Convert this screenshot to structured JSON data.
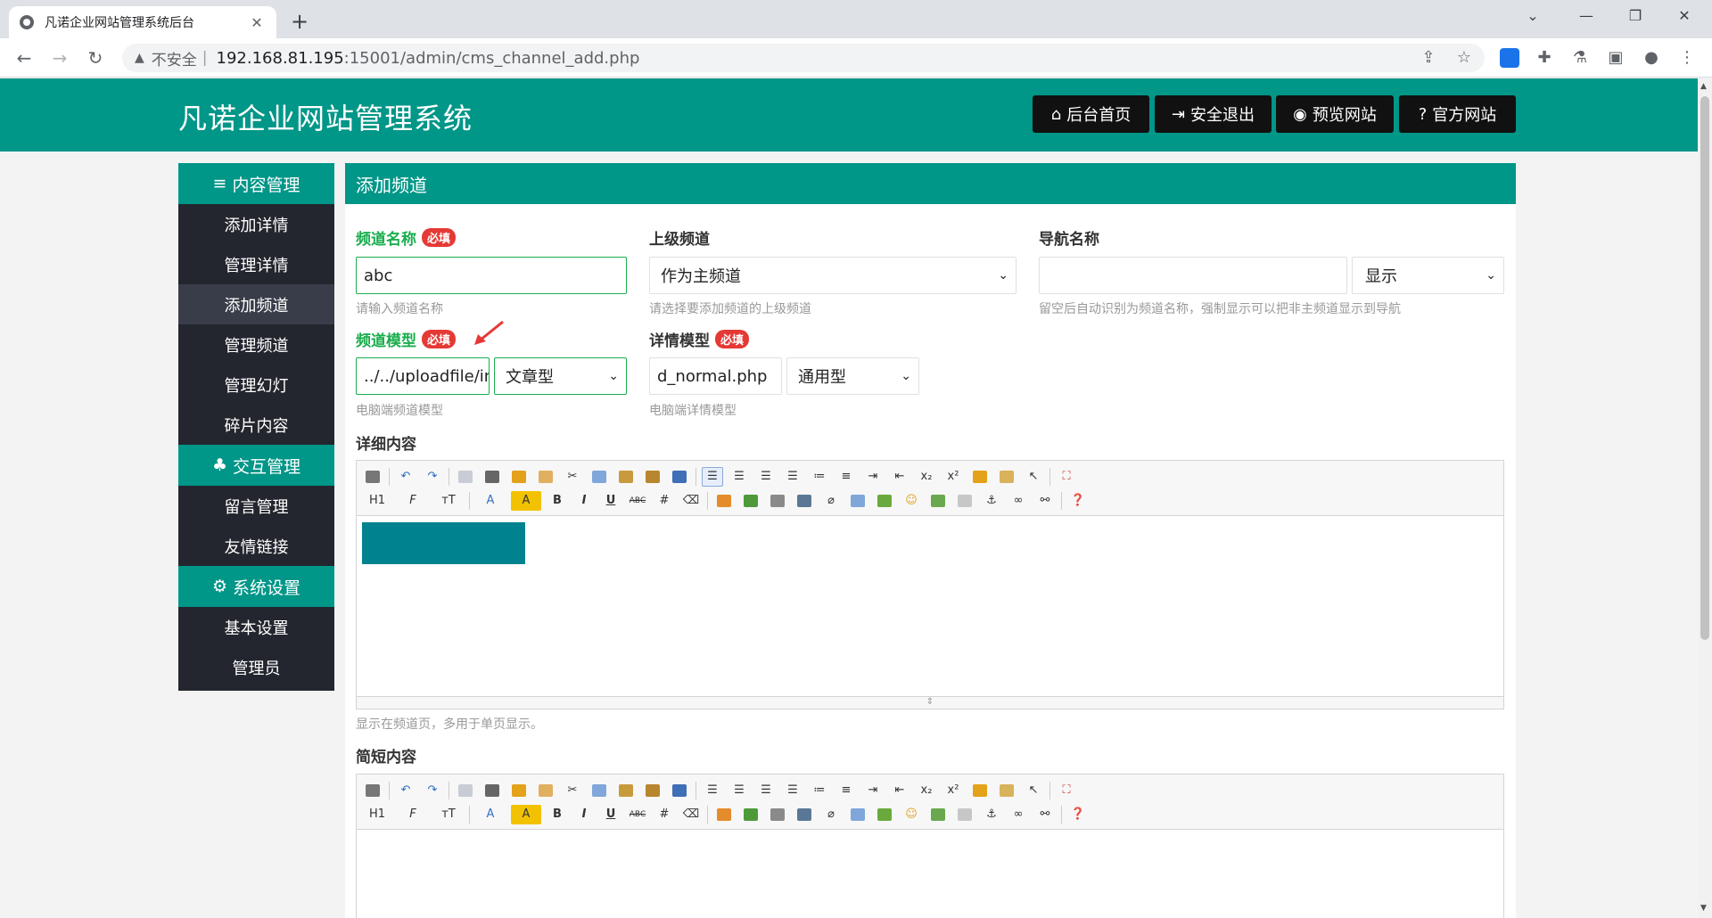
{
  "browser": {
    "tab_title": "凡诺企业网站管理系统后台",
    "tab_close": "✕",
    "new_tab": "+",
    "insecure_label": "不安全",
    "separator": "|",
    "url_host": "192.168.81.195",
    "url_path": ":15001/admin/cms_channel_add.php"
  },
  "header": {
    "brand": "凡诺企业网站管理系统",
    "buttons": [
      {
        "icon": "home-icon",
        "glyph": "⌂",
        "label": "后台首页"
      },
      {
        "icon": "logout-icon",
        "glyph": "⇥",
        "label": "安全退出"
      },
      {
        "icon": "eye-icon",
        "glyph": "◉",
        "label": "预览网站"
      },
      {
        "icon": "question-icon",
        "glyph": "?",
        "label": "官方网站"
      }
    ]
  },
  "sidebar": {
    "groups": [
      {
        "icon": "menu-icon",
        "glyph": "≡",
        "title": "内容管理",
        "items": [
          "添加详情",
          "管理详情",
          "添加频道",
          "管理频道",
          "管理幻灯",
          "碎片内容"
        ]
      },
      {
        "icon": "users-icon",
        "glyph": "♣",
        "title": "交互管理",
        "items": [
          "留言管理",
          "友情链接"
        ]
      },
      {
        "icon": "gear-icon",
        "glyph": "⚙",
        "title": "系统设置",
        "items": [
          "基本设置",
          "管理员"
        ]
      }
    ],
    "active_item": "添加频道"
  },
  "main": {
    "title": "添加频道",
    "required_badge": "必填",
    "channel_name": {
      "label": "频道名称",
      "value": "abc",
      "hint": "请输入频道名称"
    },
    "parent_channel": {
      "label": "上级频道",
      "value": "作为主频道",
      "hint": "请选择要添加频道的上级频道"
    },
    "nav_name": {
      "label": "导航名称",
      "value": "",
      "display": "显示",
      "hint": "留空后自动识别为频道名称，强制显示可以把非主频道显示到导航"
    },
    "channel_model": {
      "label": "频道模型",
      "value": "../../uploadfile/in",
      "type": "文章型",
      "hint": "电脑端频道模型"
    },
    "detail_model": {
      "label": "详情模型",
      "value": "d_normal.php",
      "type": "通用型",
      "hint": "电脑端详情模型"
    },
    "detail_content": {
      "label": "详细内容",
      "hint": "显示在频道页，多用于单页显示。"
    },
    "short_content": {
      "label": "简短内容"
    }
  },
  "editor_toolbar": {
    "row1": [
      "source",
      "undo",
      "redo",
      "|",
      "preview",
      "print",
      "template",
      "code",
      "cut",
      "copy",
      "paste",
      "paste-text",
      "paste-word",
      "|",
      "align-left",
      "align-center",
      "align-right",
      "align-justify",
      "ordered-list",
      "unordered-list",
      "indent",
      "outdent",
      "subscript",
      "superscript",
      "clear-format",
      "select-all",
      "|",
      "fullscreen"
    ],
    "row2_text": {
      "heading": "H1",
      "font": "F",
      "size": "тT",
      "forecolor": "A",
      "backcolor": "A",
      "bold": "B",
      "italic": "I",
      "underline": "U",
      "strike": "ABC"
    },
    "colors": {
      "brand": "#009688",
      "sidebar": "#23262e",
      "active": "#393d49",
      "required": "#e53935",
      "green_label": "#1aad4e",
      "arrow": "#e53935"
    }
  }
}
